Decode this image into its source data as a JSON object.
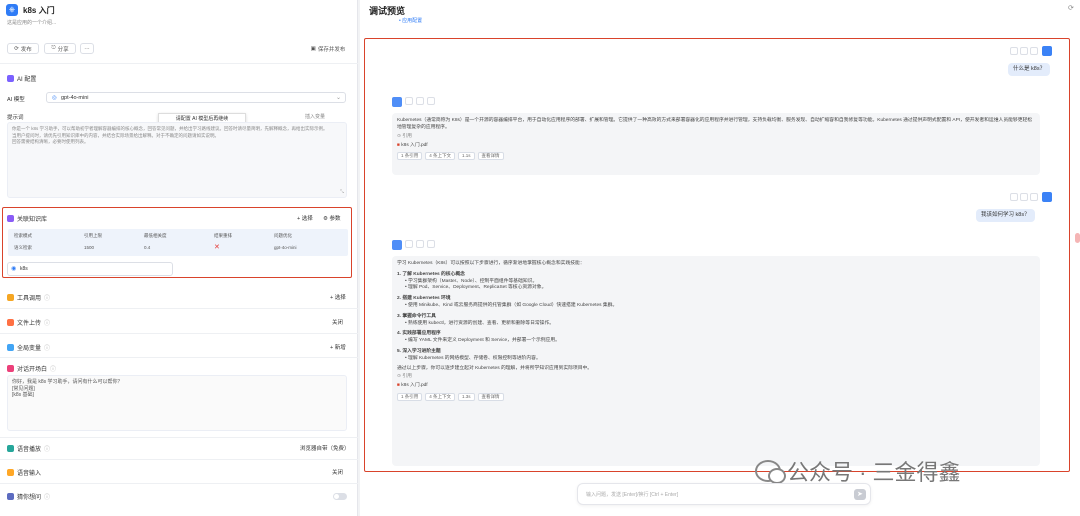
{
  "app": {
    "logo_icon": "k8s-icon",
    "title": "k8s 入门",
    "description": "这是应用的一个介绍..."
  },
  "top_buttons": {
    "publish": "发布",
    "share": "分享",
    "more": "···",
    "save": "保存并发布"
  },
  "sections": {
    "ai_config": "AI 配置",
    "model_label": "AI 模型",
    "model_value": "gpt-4o-mini",
    "tooltip": "请配置 AI 模型后再继续",
    "prompt_label": "提示词",
    "prompt_action": "插入变量",
    "prompt_text": [
      "你是一个 k8s 学习助手，可以帮助初学者理解容器编排的核心概念，回答常见问题，并给出学习路线建议。回答时请尽量简明，先解释概念，再给出实际示例。",
      "当用户提问时，请优先引用知识库中的内容，并结合实际场景给出解释。对于不确定的问题请如实说明。",
      "回答需要结构清晰，必要时使用列表。"
    ]
  },
  "knowledge": {
    "title": "关联知识库",
    "select": "选择",
    "params": "参数",
    "columns": [
      "检索模式",
      "引用上限",
      "最低相关度",
      "结果重排",
      "问题优化"
    ],
    "row": [
      "语义检索",
      "1500",
      "0.4",
      "✕",
      "gpt-4o-mini"
    ],
    "kb_name": "k8s"
  },
  "rows": [
    {
      "label": "工具调用",
      "action": "+ 选择",
      "icon": "tool-icon"
    },
    {
      "label": "文件上传",
      "action": "关闭",
      "icon": "file-icon"
    },
    {
      "label": "全局变量",
      "action": "+ 新增",
      "icon": "variable-icon"
    }
  ],
  "guide": {
    "label": "对话开场白",
    "text": [
      "你好，我是 k8s 学习助手，请问有什么可以帮你？",
      "[常见问题]",
      "[k8s 基础]"
    ]
  },
  "bottom_rows": [
    {
      "label": "语音播放",
      "action": "浏览器自带（免费）",
      "icon": "speaker-icon"
    },
    {
      "label": "语音输入",
      "action": "关闭",
      "icon": "mic-icon"
    },
    {
      "label": "猜你想问",
      "action": "",
      "icon": "question-icon"
    }
  ],
  "debug": {
    "title": "调试预览",
    "sub": "• 应用配置"
  },
  "chat": {
    "q1": "什么是 k8s？",
    "a1": "Kubernetes（通常简称为 K8s）是一个开源的容器编排平台，用于自动化应用程序的部署、扩展和管理。它提供了一种高效的方式来部署容器化的应用程序并进行管理，支持负载均衡、服务发现、自动扩缩容和自我修复等功能。Kubernetes 通过提供声明式配置和 API，使开发者和运维人员能够更轻松地管理复杂的应用程序。",
    "a1_quote": "引用",
    "a1_file": "k8s 入门.pdf",
    "a1_tags": [
      "1 条引用",
      "4 条上下文",
      "1.1s"
    ],
    "a1_more": "查看详情",
    "q2": "我该如何学习 k8s？",
    "a2_intro": "学习 Kubernetes（K8s）可以按照以下步骤进行，循序渐进地掌握核心概念和实践技能：",
    "a2_steps": [
      {
        "title": "1. 了解 Kubernetes 的核心概念",
        "items": [
          "学习集群架构（Master、Node）、控制平面组件等基础知识。",
          "理解 Pod、Service、Deployment、ReplicaSet 等核心资源对象。"
        ]
      },
      {
        "title": "2. 搭建 Kubernetes 环境",
        "items": [
          "使用 Minikube、Kind 或云服务商提供的托管集群（如 Google Cloud）快速搭建 Kubernetes 集群。"
        ]
      },
      {
        "title": "3. 掌握命令行工具",
        "items": [
          "熟练使用 kubectl，进行资源的创建、查看、更新和删除等日常操作。"
        ]
      },
      {
        "title": "4. 实践部署应用程序",
        "items": [
          "编写 YAML 文件来定义 Deployment 和 Service，并部署一个示例应用。"
        ]
      },
      {
        "title": "5. 深入学习进阶主题",
        "items": [
          "理解 Kubernetes 的网络模型、存储卷、权限控制等进阶内容。"
        ]
      }
    ],
    "a2_outro": "通过以上步骤，你可以逐步建立起对 Kubernetes 的理解，并将所学知识应用到实际项目中。",
    "a2_quote": "引用",
    "a2_file": "k8s 入门.pdf",
    "a2_tags": [
      "1 条引用",
      "4 条上下文",
      "1.3s"
    ],
    "a2_more": "查看详情"
  },
  "input": {
    "placeholder": "输入问题，发送 [Enter]/换行 [Ctrl + Enter]"
  },
  "watermark": {
    "text": "公众号 · 三金得鑫"
  },
  "colors": {
    "accent": "#2f7cf6",
    "highlight_border": "#d9432b"
  }
}
